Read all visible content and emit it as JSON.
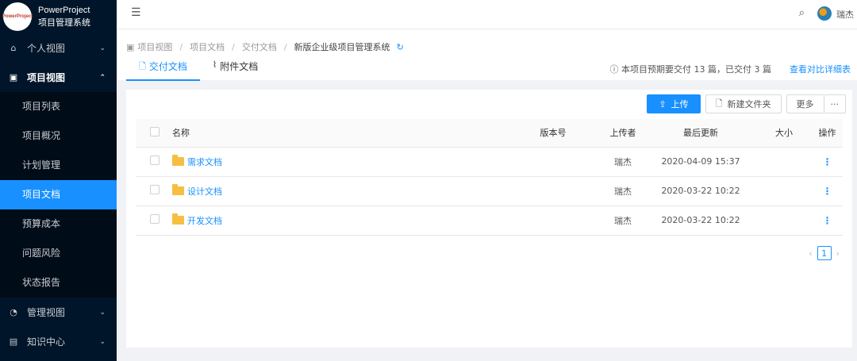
{
  "app": {
    "logo_mini": "PowerProject",
    "name": "PowerProject",
    "subtitle": "项目管理系统"
  },
  "sidebar": {
    "groups": [
      {
        "label": "个人视图",
        "icon": "home-icon",
        "expanded": false
      },
      {
        "label": "项目视图",
        "icon": "project-icon",
        "expanded": true,
        "items": [
          {
            "label": "项目列表"
          },
          {
            "label": "项目概况"
          },
          {
            "label": "计划管理"
          },
          {
            "label": "项目文档",
            "active": true
          },
          {
            "label": "预算成本"
          },
          {
            "label": "问题风险"
          },
          {
            "label": "状态报告"
          }
        ]
      },
      {
        "label": "管理视图",
        "icon": "dashboard-icon",
        "expanded": false
      },
      {
        "label": "知识中心",
        "icon": "book-icon",
        "expanded": false
      }
    ]
  },
  "header": {
    "user": "瑞杰"
  },
  "breadcrumb": [
    "项目视图",
    "项目文档",
    "交付文档",
    "新版企业级项目管理系统"
  ],
  "tabs": [
    {
      "label": "交付文档",
      "active": true
    },
    {
      "label": "附件文档",
      "active": false
    }
  ],
  "info_text": "本项目预期要交付 13 篇，已交付 3 篇",
  "detail_link": "查看对比详细表",
  "toolbar": {
    "upload": "上传",
    "new_folder": "新建文件夹",
    "more": "更多",
    "more_dots": "···"
  },
  "table": {
    "columns": [
      "名称",
      "版本号",
      "上传者",
      "最后更新",
      "大小",
      "操作"
    ],
    "rows": [
      {
        "name": "需求文档",
        "version": "",
        "uploader": "瑞杰",
        "updated": "2020-04-09 15:37",
        "size": ""
      },
      {
        "name": "设计文档",
        "version": "",
        "uploader": "瑞杰",
        "updated": "2020-03-22 10:22",
        "size": ""
      },
      {
        "name": "开发文档",
        "version": "",
        "uploader": "瑞杰",
        "updated": "2020-03-22 10:22",
        "size": ""
      }
    ]
  },
  "pagination": {
    "current": "1"
  },
  "colors": {
    "sidebar_bg": "#001529",
    "accent": "#1890ff",
    "folder": "#f5bf42"
  }
}
